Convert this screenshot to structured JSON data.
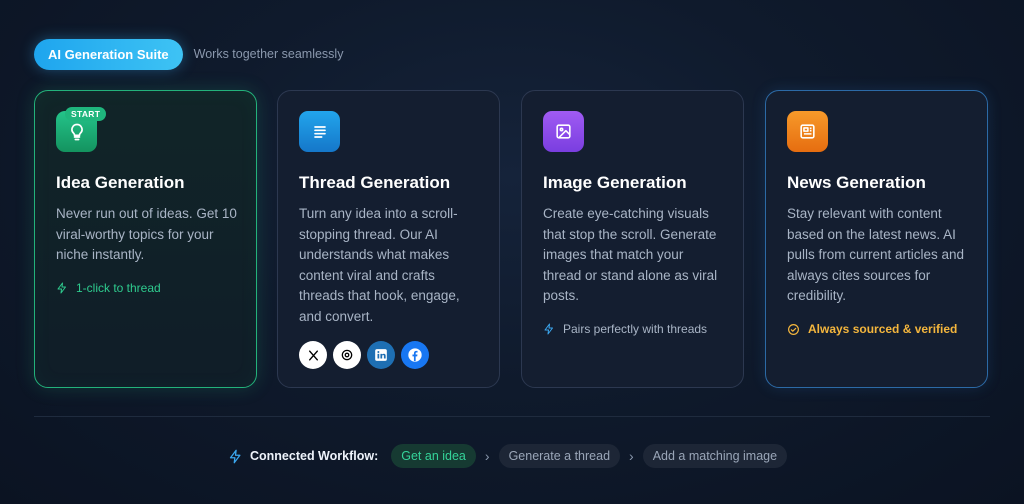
{
  "header": {
    "badge": "AI Generation Suite",
    "subtitle": "Works together seamlessly"
  },
  "cards": [
    {
      "id": "idea",
      "icon": "lightbulb-icon",
      "badge": "START",
      "title": "Idea Generation",
      "description": "Never run out of ideas. Get 10 viral-worthy topics for your niche instantly.",
      "footer": "1-click to thread",
      "footer_icon": "lightning-icon"
    },
    {
      "id": "thread",
      "icon": "document-lines-icon",
      "title": "Thread Generation",
      "description": "Turn any idea into a scroll-stopping thread. Our AI understands what makes content viral and crafts threads that hook, engage, and convert.",
      "socials": [
        "x-icon",
        "threads-icon",
        "linkedin-icon",
        "facebook-icon"
      ]
    },
    {
      "id": "image",
      "icon": "image-icon",
      "title": "Image Generation",
      "description": "Create eye-catching visuals that stop the scroll. Generate images that match your thread or stand alone as viral posts.",
      "footer": "Pairs perfectly with threads",
      "footer_icon": "lightning-icon"
    },
    {
      "id": "news",
      "icon": "newspaper-icon",
      "title": "News Generation",
      "description": "Stay relevant with content based on the latest news. AI pulls from current articles and always cites sources for credibility.",
      "footer": "Always sourced & verified",
      "footer_icon": "check-circle-icon"
    }
  ],
  "workflow": {
    "label": "Connected Workflow:",
    "steps": [
      "Get an idea",
      "Generate a thread",
      "Add a matching image"
    ]
  },
  "colors": {
    "accent_green": "#23b27b",
    "accent_blue": "#1ea5ee",
    "accent_purple": "#8e4ced",
    "accent_orange": "#f08a1e",
    "accent_gold": "#f4b63d"
  }
}
